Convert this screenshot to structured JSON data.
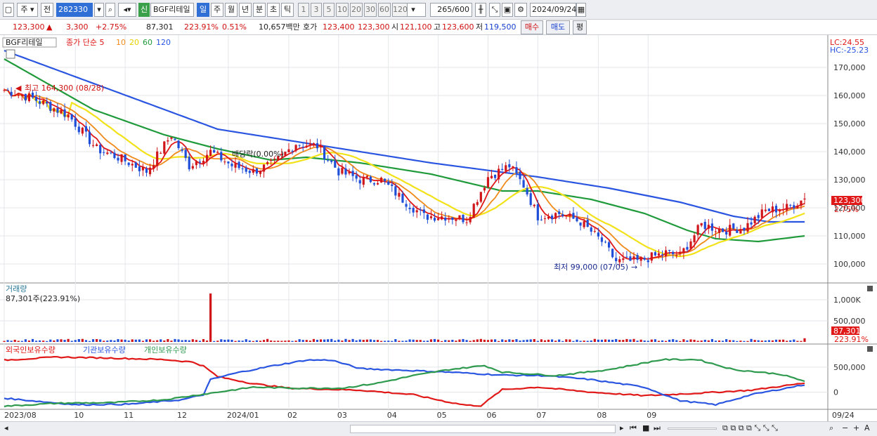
{
  "toolbar": {
    "period": "주",
    "prev": "전",
    "code": "282330",
    "badge": "신",
    "stock_name": "BGF리테일",
    "tabs": [
      "일",
      "주",
      "월",
      "년",
      "분",
      "초",
      "틱"
    ],
    "nums": [
      "1",
      "3",
      "5",
      "10",
      "20",
      "30",
      "60",
      "120"
    ],
    "count": "265",
    "count_total": "/600",
    "date": "2024/09/24"
  },
  "quote": {
    "price": "123,300",
    "arrow": "▲",
    "change": "3,300",
    "change_pct": "+2.75%",
    "volume": "87,301",
    "volume_pct": "223.91%",
    "turnover_pct": "0.51%",
    "amount": "10,657백만",
    "ask_label": "호가",
    "ask": "123,400",
    "bid": "123,300",
    "open_label": "시",
    "open": "121,100",
    "high_label": "고",
    "high": "123,600",
    "low_label": "저",
    "low": "119,500",
    "buy": "매수",
    "sell": "매도",
    "eval": "평"
  },
  "price_panel": {
    "legend_name": "BGF리테일",
    "legend_ma": "종가 단순 5",
    "ma_periods": [
      "10",
      "20",
      "60",
      "120"
    ],
    "lc": "LC:24.55",
    "hc": "HC:-25.23",
    "high_note": "최고 164,300 (08/28)",
    "low_note": "최저 99,000 (07/05)",
    "div_note": "배당락(0.00%)",
    "last_price": "123,300",
    "last_pct": "2.75%"
  },
  "volume_panel": {
    "title": "거래량",
    "value": "87,301주(223.91%)",
    "last": "87,301",
    "last_pct": "223.91%"
  },
  "holder_panel": {
    "series": [
      "외국인보유수량",
      "기관보유수량",
      "개인보유수량"
    ]
  },
  "colors": {
    "up": "#d0161a",
    "down": "#1f4fd8",
    "ma5": "#e01818",
    "ma10": "#f08a1a",
    "ma20": "#f2e21a",
    "ma60": "#1f9a3a",
    "ma120": "#2a55e0",
    "foreign": "#e01818",
    "inst": "#2a55e0",
    "indiv": "#2e9a4e"
  },
  "chart_data": [
    {
      "type": "candlestick",
      "title": "BGF리테일",
      "x_ticks": [
        "2023/08",
        "10",
        "11",
        "12",
        "2024/01",
        "02",
        "03",
        "04",
        "05",
        "06",
        "07",
        "08",
        "09",
        "09/24"
      ],
      "y_ticks": [
        "170,000",
        "160,000",
        "150,000",
        "140,000",
        "130,000",
        "120,000",
        "110,000",
        "100,000"
      ],
      "ylim": [
        94000,
        177000
      ],
      "close_path": [
        [
          0,
          162000
        ],
        [
          8,
          159000
        ],
        [
          18,
          153000
        ],
        [
          26,
          141000
        ],
        [
          32,
          138000
        ],
        [
          40,
          133000
        ],
        [
          47,
          146000
        ],
        [
          52,
          135000
        ],
        [
          58,
          140000
        ],
        [
          64,
          135000
        ],
        [
          70,
          133000
        ],
        [
          76,
          136000
        ],
        [
          82,
          143000
        ],
        [
          88,
          142000
        ],
        [
          94,
          133000
        ],
        [
          100,
          130000
        ],
        [
          106,
          130000
        ],
        [
          112,
          123000
        ],
        [
          118,
          117000
        ],
        [
          124,
          117000
        ],
        [
          130,
          116000
        ],
        [
          136,
          131000
        ],
        [
          142,
          135000
        ],
        [
          146,
          128000
        ],
        [
          150,
          117000
        ],
        [
          156,
          118000
        ],
        [
          162,
          115000
        ],
        [
          168,
          108000
        ],
        [
          172,
          101000
        ],
        [
          178,
          101000
        ],
        [
          186,
          104000
        ],
        [
          190,
          103000
        ],
        [
          196,
          114000
        ],
        [
          202,
          112000
        ],
        [
          208,
          113000
        ],
        [
          214,
          119000
        ],
        [
          220,
          120000
        ],
        [
          225,
          123300
        ]
      ],
      "ma_lines": [
        {
          "name": "120",
          "path": [
            [
              0,
              176000
            ],
            [
              30,
              162000
            ],
            [
              60,
              148000
            ],
            [
              90,
              142000
            ],
            [
              120,
              136000
            ],
            [
              150,
              131000
            ],
            [
              170,
              127000
            ],
            [
              190,
              122000
            ],
            [
              205,
              117000
            ],
            [
              215,
              115000
            ],
            [
              225,
              115000
            ]
          ]
        },
        {
          "name": "60",
          "path": [
            [
              0,
              173000
            ],
            [
              25,
              155000
            ],
            [
              45,
              146000
            ],
            [
              60,
              141000
            ],
            [
              75,
              137000
            ],
            [
              85,
              138000
            ],
            [
              100,
              136000
            ],
            [
              120,
              132000
            ],
            [
              140,
              126000
            ],
            [
              150,
              126000
            ],
            [
              165,
              123000
            ],
            [
              180,
              118000
            ],
            [
              192,
              112000
            ],
            [
              200,
              109000
            ],
            [
              212,
              108000
            ],
            [
              225,
              110000
            ]
          ]
        }
      ],
      "annotations": [
        "최고 164,300 (08/28)",
        "최저 99,000 (07/05)",
        "배당락(0.00%)"
      ],
      "last_value": 123300
    },
    {
      "type": "bar",
      "title": "거래량",
      "y_ticks": [
        "1,000K",
        "500,000"
      ],
      "ylim": [
        0,
        1150000
      ],
      "typical_volume": 40000,
      "spike": {
        "week_index": 58,
        "value": 1150000
      },
      "last_value": 87301
    },
    {
      "type": "line",
      "y_ticks": [
        "500,000",
        "0"
      ],
      "series": [
        {
          "name": "외국인보유수량",
          "path": [
            [
              0,
              640000
            ],
            [
              15,
              700000
            ],
            [
              30,
              680000
            ],
            [
              45,
              650000
            ],
            [
              53,
              600000
            ],
            [
              56,
              520000
            ],
            [
              60,
              310000
            ],
            [
              70,
              170000
            ],
            [
              80,
              80000
            ],
            [
              100,
              40000
            ],
            [
              115,
              -50000
            ],
            [
              125,
              -200000
            ],
            [
              130,
              -260000
            ],
            [
              134,
              -270000
            ],
            [
              140,
              50000
            ],
            [
              150,
              100000
            ],
            [
              165,
              0
            ],
            [
              180,
              -70000
            ],
            [
              195,
              -20000
            ],
            [
              210,
              40000
            ],
            [
              225,
              180000
            ]
          ]
        },
        {
          "name": "기관보유수량",
          "path": [
            [
              0,
              -120000
            ],
            [
              20,
              -250000
            ],
            [
              35,
              -240000
            ],
            [
              50,
              -150000
            ],
            [
              56,
              -50000
            ],
            [
              58,
              250000
            ],
            [
              65,
              380000
            ],
            [
              75,
              520000
            ],
            [
              85,
              640000
            ],
            [
              92,
              640000
            ],
            [
              100,
              470000
            ],
            [
              115,
              430000
            ],
            [
              125,
              400000
            ],
            [
              140,
              340000
            ],
            [
              152,
              330000
            ],
            [
              165,
              250000
            ],
            [
              180,
              100000
            ],
            [
              190,
              -170000
            ],
            [
              200,
              -250000
            ],
            [
              210,
              -50000
            ],
            [
              225,
              150000
            ]
          ]
        },
        {
          "name": "개인보유수량",
          "path": [
            [
              0,
              -280000
            ],
            [
              15,
              -220000
            ],
            [
              30,
              -210000
            ],
            [
              45,
              -150000
            ],
            [
              58,
              -20000
            ],
            [
              70,
              100000
            ],
            [
              82,
              80000
            ],
            [
              95,
              80000
            ],
            [
              105,
              180000
            ],
            [
              115,
              330000
            ],
            [
              125,
              450000
            ],
            [
              135,
              530000
            ],
            [
              140,
              400000
            ],
            [
              155,
              330000
            ],
            [
              170,
              450000
            ],
            [
              185,
              650000
            ],
            [
              195,
              650000
            ],
            [
              205,
              450000
            ],
            [
              218,
              360000
            ],
            [
              225,
              220000
            ]
          ]
        }
      ]
    }
  ]
}
